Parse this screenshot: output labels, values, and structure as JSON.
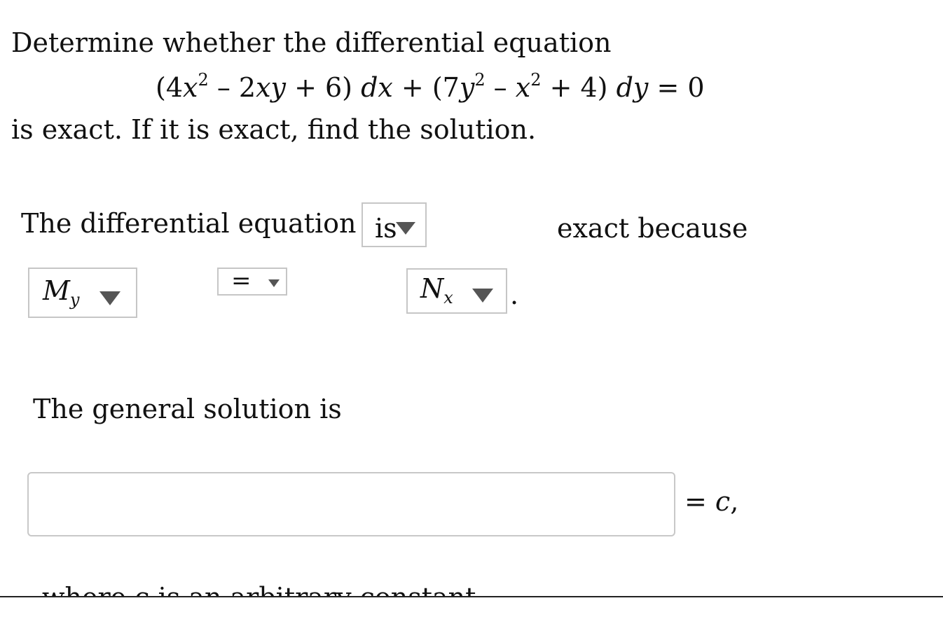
{
  "problem": {
    "intro": "Determine whether the differential equation",
    "equation": {
      "open1": "(4",
      "x1": "x",
      "sq1": "2",
      "t1": " – 2",
      "xy1": "xy",
      "t2": " + 6) ",
      "dx": "dx",
      "t3": " + (7",
      "y1": "y",
      "sq2": "2",
      "t4": " – ",
      "x2": "x",
      "sq3": "2",
      "t5": " + 4) ",
      "dy": "dy",
      "t6": " = 0"
    },
    "outro": "is exact. If it is exact, find the solution."
  },
  "exactness": {
    "lead_text": "The differential equation",
    "is_dropdown_value": "is",
    "trail_text": "exact because",
    "my_dropdown": {
      "base": "M",
      "sub": "y"
    },
    "relation_dropdown_value": "=",
    "nx_dropdown": {
      "base": "N",
      "sub": "x"
    },
    "period": "."
  },
  "solution": {
    "lead_text": "The general solution is",
    "answer_value": "",
    "equals_c": {
      "eq": "= ",
      "c": "c",
      "comma": ","
    },
    "footer_text": "where c is an arbitrary constant."
  }
}
